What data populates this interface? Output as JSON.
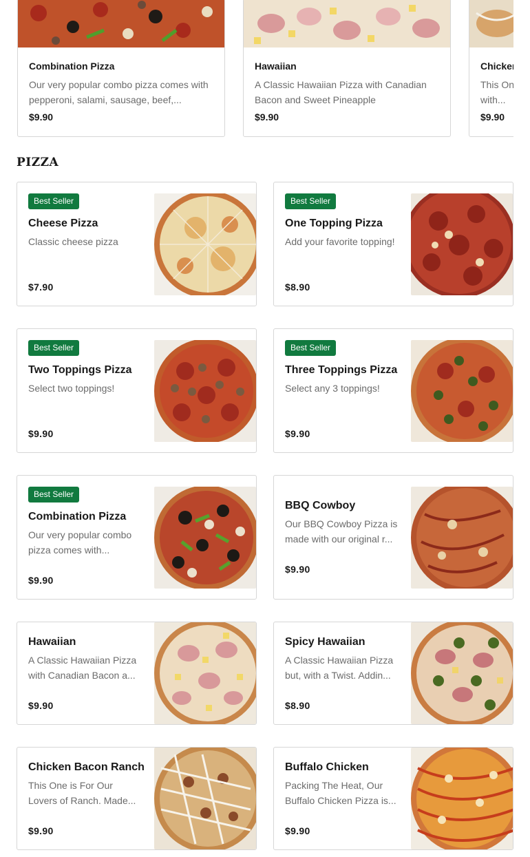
{
  "featured": [
    {
      "title": "Combination Pizza",
      "description": "Our very popular combo pizza comes with pepperoni, salami, sausage, beef,...",
      "price": "$9.90",
      "image": "combination-pizza-photo"
    },
    {
      "title": "Hawaiian",
      "description": "A Classic Hawaiian Pizza with Canadian Bacon and Sweet Pineapple",
      "price": "$9.90",
      "image": "hawaiian-pizza-photo"
    },
    {
      "title": "Chicken Bacon Ranch",
      "description": "This One is For Our Lovers of Ranch. Made with...",
      "price": "$9.90",
      "image": "chicken-bacon-ranch-photo"
    }
  ],
  "section": {
    "title": "PIZZA"
  },
  "menu": [
    {
      "badge": "Best Seller",
      "title": "Cheese Pizza",
      "description": "Classic cheese pizza",
      "price": "$7.90",
      "image": "cheese-pizza-photo"
    },
    {
      "badge": "Best Seller",
      "title": "One Topping Pizza",
      "description": "Add your favorite topping!",
      "price": "$8.90",
      "image": "pepperoni-pizza-photo"
    },
    {
      "badge": "Best Seller",
      "title": "Two Toppings Pizza",
      "description": "Select two toppings!",
      "price": "$9.90",
      "image": "pepperoni-sausage-pizza-photo"
    },
    {
      "badge": "Best Seller",
      "title": "Three Toppings Pizza",
      "description": "Select any 3 toppings!",
      "price": "$9.90",
      "image": "jalapeno-pizza-photo"
    },
    {
      "badge": "Best Seller",
      "title": "Combination Pizza",
      "description": "Our very popular combo pizza comes with...",
      "price": "$9.90",
      "image": "combination-pizza-photo"
    },
    {
      "badge": "",
      "title": "BBQ Cowboy",
      "description": "Our BBQ Cowboy Pizza is made with our original r...",
      "price": "$9.90",
      "image": "bbq-pizza-photo"
    },
    {
      "badge": "",
      "title": "Hawaiian",
      "description": "A Classic Hawaiian Pizza with Canadian Bacon a...",
      "price": "$9.90",
      "image": "hawaiian-pizza-photo"
    },
    {
      "badge": "",
      "title": "Spicy Hawaiian",
      "description": "A Classic Hawaiian Pizza but, with a Twist. Addin...",
      "price": "$8.90",
      "image": "spicy-hawaiian-pizza-photo"
    },
    {
      "badge": "",
      "title": "Chicken Bacon Ranch",
      "description": "This One is For Our Lovers of Ranch. Made...",
      "price": "$9.90",
      "image": "chicken-bacon-ranch-photo"
    },
    {
      "badge": "",
      "title": "Buffalo Chicken",
      "description": "Packing The Heat, Our Buffalo Chicken Pizza is...",
      "price": "$9.90",
      "image": "buffalo-chicken-pizza-photo"
    }
  ],
  "colors": {
    "badge_bg": "#117a3f",
    "text_primary": "#191919",
    "text_secondary": "#6b6b6b",
    "border": "#d6d6d6"
  }
}
